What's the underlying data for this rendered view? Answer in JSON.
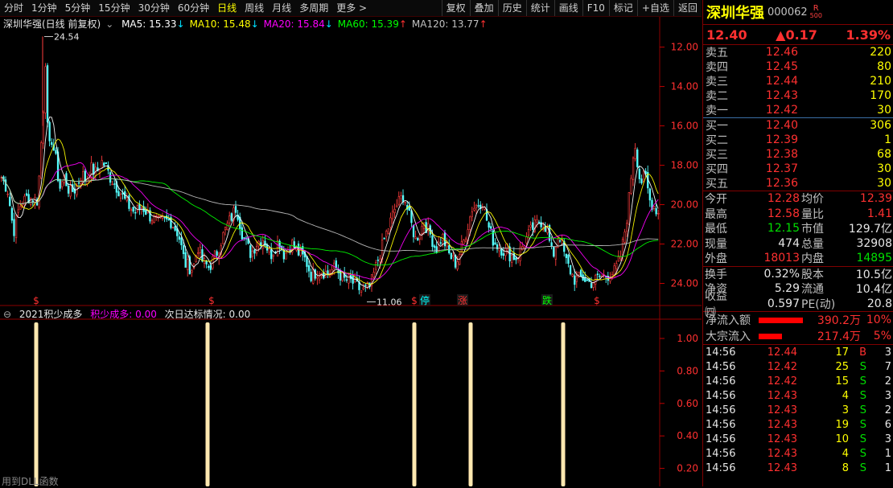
{
  "toolbar": {
    "periods": [
      "分时",
      "1分钟",
      "5分钟",
      "15分钟",
      "30分钟",
      "60分钟",
      "日线",
      "周线",
      "月线",
      "多周期",
      "更多 >"
    ],
    "active": "日线",
    "actions": [
      "复权",
      "叠加",
      "历史",
      "统计",
      "画线",
      "F10",
      "标记",
      "+自选",
      "返回"
    ]
  },
  "main": {
    "title": "深圳华强(日线 前复权)",
    "ma": [
      {
        "label": "MA5: 15.33",
        "arrow": "↓",
        "color": "#ffffff"
      },
      {
        "label": "MA10: 15.48",
        "arrow": "↓",
        "color": "#ffff00"
      },
      {
        "label": "MA20: 15.84",
        "arrow": "↓",
        "color": "#ff00ff"
      },
      {
        "label": "MA60: 15.39",
        "arrow": "↑",
        "color": "#00ff00"
      },
      {
        "label": "MA120: 13.77",
        "arrow": "↑",
        "color": "#c0c0c0"
      }
    ],
    "high_label": "24.54",
    "low_label": "11.06",
    "yticks": [
      "24.00",
      "22.00",
      "20.00",
      "18.00",
      "16.00",
      "14.00",
      "12.00"
    ],
    "markers": [
      {
        "text": "$",
        "color": "#ff3030"
      },
      {
        "text": "$",
        "color": "#ff3030"
      },
      {
        "text": "$",
        "color": "#ff3030"
      },
      {
        "text": "停",
        "color": "#00ffff",
        "bg": true
      },
      {
        "text": "涨",
        "color": "#ff3030",
        "bg": true
      },
      {
        "text": "跌",
        "color": "#00ff00",
        "bg": true
      },
      {
        "text": "$",
        "color": "#ff3030"
      }
    ]
  },
  "indicator": {
    "name": "2021积少成多",
    "param1": "积少成多: 0.00",
    "param2": "次日达标情况: 0.00",
    "yticks": [
      "1.00",
      "0.80",
      "0.60",
      "0.40",
      "0.20"
    ]
  },
  "chart_data": {
    "type": "candlestick",
    "title": "深圳华强(日线 前复权)",
    "ylim": [
      11.0,
      24.8
    ],
    "yticks": [
      12,
      14,
      16,
      18,
      20,
      22,
      24
    ],
    "anchors": [
      [
        0,
        17.4
      ],
      [
        8,
        16.7
      ],
      [
        15,
        14.6
      ],
      [
        22,
        15.9
      ],
      [
        32,
        16.4
      ],
      [
        38,
        16.3
      ],
      [
        45,
        16.2
      ],
      [
        52,
        20.9
      ],
      [
        55,
        23.7
      ],
      [
        58,
        18.5
      ],
      [
        62,
        19.4
      ],
      [
        68,
        18.2
      ],
      [
        72,
        16.8
      ],
      [
        78,
        17.4
      ],
      [
        85,
        16.6
      ],
      [
        92,
        16.8
      ],
      [
        100,
        17.6
      ],
      [
        105,
        17.2
      ],
      [
        110,
        17.9
      ],
      [
        118,
        17.6
      ],
      [
        125,
        18.2
      ],
      [
        130,
        17.9
      ],
      [
        135,
        17.4
      ],
      [
        140,
        17.1
      ],
      [
        148,
        16.6
      ],
      [
        155,
        16.1
      ],
      [
        165,
        15.6
      ],
      [
        175,
        15.9
      ],
      [
        185,
        15.4
      ],
      [
        195,
        15.1
      ],
      [
        210,
        15.2
      ],
      [
        220,
        14.5
      ],
      [
        228,
        13.0
      ],
      [
        238,
        12.7
      ],
      [
        244,
        13.9
      ],
      [
        250,
        13.1
      ],
      [
        258,
        12.8
      ],
      [
        268,
        13.6
      ],
      [
        278,
        14.7
      ],
      [
        292,
        15.9
      ],
      [
        300,
        14.4
      ],
      [
        310,
        13.5
      ],
      [
        318,
        14.1
      ],
      [
        326,
        14.3
      ],
      [
        334,
        13.4
      ],
      [
        345,
        14.2
      ],
      [
        352,
        13.4
      ],
      [
        360,
        14.1
      ],
      [
        370,
        13.5
      ],
      [
        378,
        13.2
      ],
      [
        385,
        12.4
      ],
      [
        395,
        12.7
      ],
      [
        405,
        12.5
      ],
      [
        415,
        12.8
      ],
      [
        425,
        12.2
      ],
      [
        435,
        12.1
      ],
      [
        448,
        11.6
      ],
      [
        458,
        11.8
      ],
      [
        468,
        13.2
      ],
      [
        478,
        14.5
      ],
      [
        490,
        15.9
      ],
      [
        500,
        16.5
      ],
      [
        508,
        15.2
      ],
      [
        515,
        14.2
      ],
      [
        525,
        15.1
      ],
      [
        532,
        14.6
      ],
      [
        540,
        13.7
      ],
      [
        548,
        14.4
      ],
      [
        556,
        13.5
      ],
      [
        565,
        13.0
      ],
      [
        575,
        14.2
      ],
      [
        585,
        15.8
      ],
      [
        598,
        16.2
      ],
      [
        605,
        14.9
      ],
      [
        612,
        14.1
      ],
      [
        620,
        13.8
      ],
      [
        630,
        13.5
      ],
      [
        640,
        13.3
      ],
      [
        650,
        14.1
      ],
      [
        660,
        14.8
      ],
      [
        670,
        15.2
      ],
      [
        678,
        14.8
      ],
      [
        685,
        13.3
      ],
      [
        693,
        14.6
      ],
      [
        702,
        13.1
      ],
      [
        712,
        12.2
      ],
      [
        722,
        12.3
      ],
      [
        732,
        12.0
      ],
      [
        742,
        12.3
      ],
      [
        752,
        12.4
      ],
      [
        762,
        12.6
      ],
      [
        770,
        13.4
      ],
      [
        778,
        15.5
      ],
      [
        787,
        19.3
      ],
      [
        794,
        17.1
      ],
      [
        800,
        17.5
      ],
      [
        806,
        16.2
      ],
      [
        812,
        15.9
      ],
      [
        820,
        15.3
      ]
    ],
    "high_label": 24.54,
    "low_label": 11.06,
    "ma_values": {
      "MA5": 15.33,
      "MA10": 15.48,
      "MA20": 15.84,
      "MA60": 15.39,
      "MA120": 13.77
    },
    "signals_x": [
      45,
      258,
      515,
      585,
      700
    ],
    "indicator_ylim": [
      0,
      1.0
    ]
  },
  "panel": {
    "name": "深圳华强",
    "code": "000062",
    "badge_top": "R",
    "badge_bot": "500",
    "price": "12.40",
    "change": "▲0.17",
    "pct": "1.39%",
    "asks": [
      {
        "label": "卖五",
        "price": "12.46",
        "vol": "220"
      },
      {
        "label": "卖四",
        "price": "12.45",
        "vol": "80"
      },
      {
        "label": "卖三",
        "price": "12.44",
        "vol": "210"
      },
      {
        "label": "卖二",
        "price": "12.43",
        "vol": "170"
      },
      {
        "label": "卖一",
        "price": "12.42",
        "vol": "30"
      }
    ],
    "bids": [
      {
        "label": "买一",
        "price": "12.40",
        "vol": "306"
      },
      {
        "label": "买二",
        "price": "12.39",
        "vol": "1"
      },
      {
        "label": "买三",
        "price": "12.38",
        "vol": "68"
      },
      {
        "label": "买四",
        "price": "12.37",
        "vol": "30"
      },
      {
        "label": "买五",
        "price": "12.36",
        "vol": "30"
      }
    ],
    "info1": [
      {
        "l1": "今开",
        "v1": "12.28",
        "c1": "red",
        "l2": "均价",
        "v2": "12.39",
        "c2": "red"
      },
      {
        "l1": "最高",
        "v1": "12.58",
        "c1": "red",
        "l2": "量比",
        "v2": "1.41",
        "c2": "red"
      },
      {
        "l1": "最低",
        "v1": "12.15",
        "c1": "green",
        "l2": "市值",
        "v2": "129.7亿",
        "c2": "white"
      },
      {
        "l1": "现量",
        "v1": "474",
        "c1": "white",
        "l2": "总量",
        "v2": "32908",
        "c2": "white"
      },
      {
        "l1": "外盘",
        "v1": "18013",
        "c1": "red",
        "l2": "内盘",
        "v2": "14895",
        "c2": "green"
      }
    ],
    "info2": [
      {
        "l1": "换手",
        "v1": "0.32%",
        "c1": "white",
        "l2": "股本",
        "v2": "10.5亿",
        "c2": "white"
      },
      {
        "l1": "净资",
        "v1": "5.29",
        "c1": "white",
        "l2": "流通",
        "v2": "10.4亿",
        "c2": "white"
      },
      {
        "l1": "收益㈣",
        "v1": "0.597",
        "c1": "white",
        "l2": "PE(动)",
        "v2": "20.8",
        "c2": "white"
      }
    ],
    "flows": [
      {
        "label": "净流入额",
        "value": "390.2万",
        "pct": "10%",
        "bar": 0.5
      },
      {
        "label": "大宗流入",
        "value": "217.4万",
        "pct": "5%",
        "bar": 0.26
      }
    ],
    "ticks": [
      {
        "time": "14:56",
        "price": "12.44",
        "vol": "17",
        "dir": "B",
        "n": "3"
      },
      {
        "time": "14:56",
        "price": "12.42",
        "vol": "25",
        "dir": "S",
        "n": "7"
      },
      {
        "time": "14:56",
        "price": "12.42",
        "vol": "15",
        "dir": "S",
        "n": "2"
      },
      {
        "time": "14:56",
        "price": "12.43",
        "vol": "4",
        "dir": "S",
        "n": "3"
      },
      {
        "time": "14:56",
        "price": "12.43",
        "vol": "3",
        "dir": "S",
        "n": "2"
      },
      {
        "time": "14:56",
        "price": "12.43",
        "vol": "19",
        "dir": "S",
        "n": "6"
      },
      {
        "time": "14:56",
        "price": "12.43",
        "vol": "10",
        "dir": "S",
        "n": "3"
      },
      {
        "time": "14:56",
        "price": "12.43",
        "vol": "4",
        "dir": "S",
        "n": "1"
      },
      {
        "time": "14:56",
        "price": "12.43",
        "vol": "8",
        "dir": "S",
        "n": "1"
      }
    ]
  },
  "footer": {
    "hint": "用到DLL函数"
  }
}
